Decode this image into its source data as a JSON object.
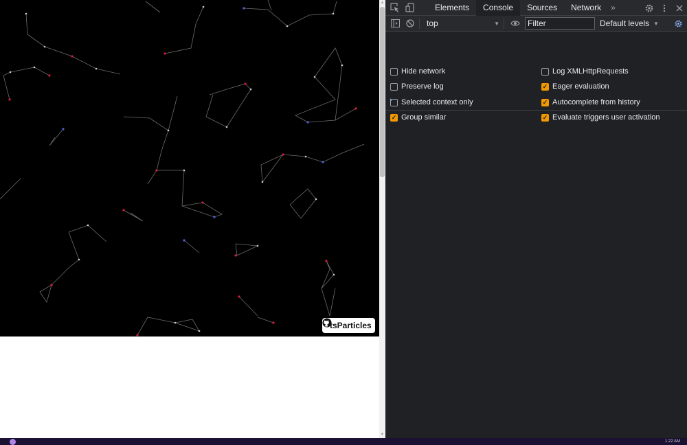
{
  "page": {
    "badge_label": "tsParticles"
  },
  "devtools": {
    "tabs": [
      {
        "label": "Elements",
        "active": false
      },
      {
        "label": "Console",
        "active": true
      },
      {
        "label": "Sources",
        "active": false
      },
      {
        "label": "Network",
        "active": false
      }
    ],
    "more_tabs_glyph": "»",
    "console": {
      "context": "top",
      "filter_placeholder": "Filter",
      "levels": "Default levels",
      "prompt": "›"
    },
    "settings": {
      "left": [
        {
          "label": "Hide network",
          "checked": false
        },
        {
          "label": "Preserve log",
          "checked": false
        },
        {
          "label": "Selected context only",
          "checked": false
        },
        {
          "label": "Group similar",
          "checked": true
        }
      ],
      "right": [
        {
          "label": "Log XMLHttpRequests",
          "checked": false
        },
        {
          "label": "Eager evaluation",
          "checked": true
        },
        {
          "label": "Autocomplete from history",
          "checked": true
        },
        {
          "label": "Evaluate triggers user activation",
          "checked": true
        }
      ]
    },
    "colors": {
      "accent_checkbox": "#f29900",
      "prompt": "#8ab4f8",
      "settings_gear_active": "#8ab4f8"
    }
  },
  "taskbar": {
    "time": "1:22 AM"
  },
  "icons": [
    "inspect-element-icon",
    "device-toolbar-icon",
    "settings-gear-icon",
    "kebab-menu-icon",
    "close-icon",
    "sidebar-toggle-icon",
    "clear-console-icon",
    "eye-icon",
    "chevron-down-icon",
    "github-icon"
  ]
}
